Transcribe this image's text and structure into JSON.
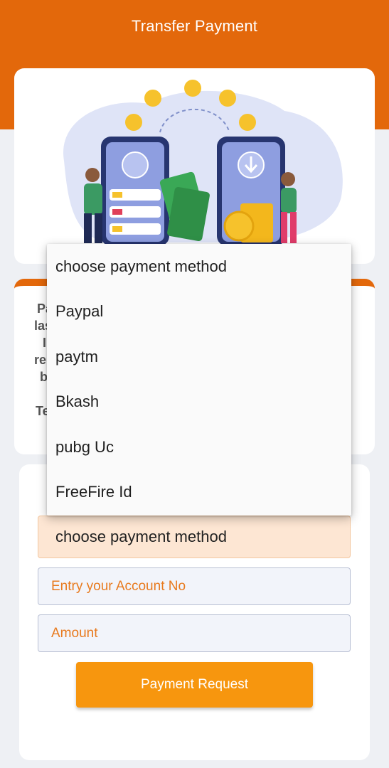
{
  "header": {
    "title": "Transfer Payment"
  },
  "info_card": {
    "visible_fragments": [
      "Pa",
      "las",
      "I",
      "re",
      "b",
      "Te"
    ]
  },
  "form": {
    "payment_method_value": "choose payment method",
    "account_placeholder": "Entry your Account No",
    "amount_placeholder": "Amount",
    "submit_label": "Payment Request"
  },
  "dropdown": {
    "options": [
      "choose payment method",
      "Paypal",
      "paytm",
      "Bkash",
      "pubg Uc",
      "FreeFire Id"
    ]
  },
  "colors": {
    "header": "#e3680b",
    "button": "#f7960e",
    "selected_field": "#fde6d3",
    "placeholder_text": "#e87a1e"
  }
}
